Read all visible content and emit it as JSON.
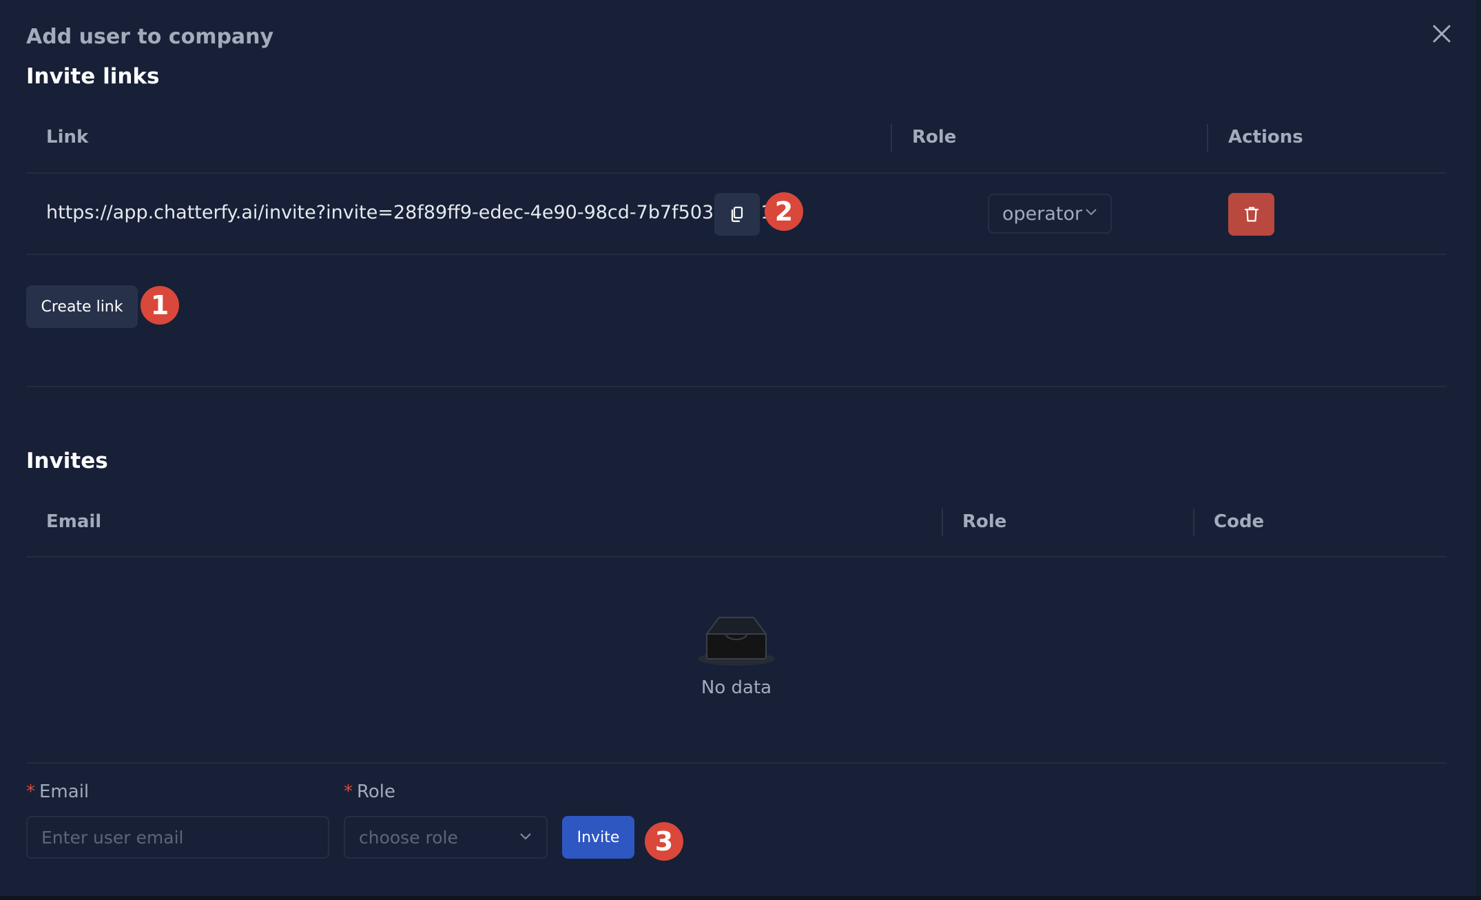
{
  "modal": {
    "title": "Add user to company"
  },
  "invite_links": {
    "title": "Invite links",
    "columns": [
      "Link",
      "Role",
      "Actions"
    ],
    "rows": [
      {
        "link": "https://app.chatterfy.ai/invite?invite=28f89ff9-edec-4e90-98cd-7b7f503e1671",
        "role": "operator"
      }
    ],
    "create_link_label": "Create link"
  },
  "invites": {
    "title": "Invites",
    "columns": [
      "Email",
      "Role",
      "Code"
    ],
    "empty_text": "No data"
  },
  "form": {
    "email_label": "Email",
    "email_placeholder": "Enter user email",
    "role_label": "Role",
    "role_placeholder": "choose role",
    "required_marker": "*",
    "invite_label": "Invite"
  },
  "annotations": {
    "badge_1": "1",
    "badge_2": "2",
    "badge_3": "3"
  },
  "icons": {
    "close": "close-icon",
    "copy": "copy-icon",
    "delete": "trash-icon",
    "chevron": "chevron-down-icon",
    "empty": "empty-inbox-icon"
  },
  "colors": {
    "background": "#172036",
    "danger": "#b9483e",
    "primary": "#2f57c2",
    "badge": "#d9483b"
  }
}
